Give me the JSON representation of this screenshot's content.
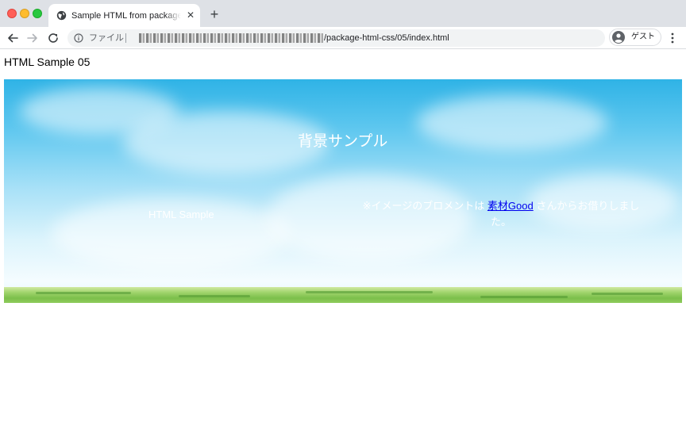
{
  "browser": {
    "tab": {
      "title": "Sample HTML from package-html-css",
      "close_glyph": "✕",
      "favicon": "globe-icon"
    },
    "new_tab_glyph": "+",
    "nav": {
      "back_icon": "arrow-left-icon",
      "forward_icon": "arrow-right-icon",
      "reload_icon": "reload-icon"
    },
    "address_bar": {
      "scheme_label": "ファイル",
      "url_visible_path": "/package-html-css/05/index.html"
    },
    "profile": {
      "label": "ゲスト"
    },
    "menu_icon": "kebab-menu-icon"
  },
  "page": {
    "heading": "HTML Sample 05",
    "hero": {
      "title": "背景サンプル",
      "subtitle": "HTML Sample",
      "credit_prefix": "※イメージのブロメントは",
      "credit_link": "素材Good",
      "credit_suffix": "さんからお借りしました。"
    }
  },
  "colors": {
    "sky_top": "#2fb3e6",
    "sky_bottom": "#f4fcff",
    "grass": "#7cbf4b",
    "link": "#0000ee",
    "tabstrip": "#dee1e6"
  }
}
